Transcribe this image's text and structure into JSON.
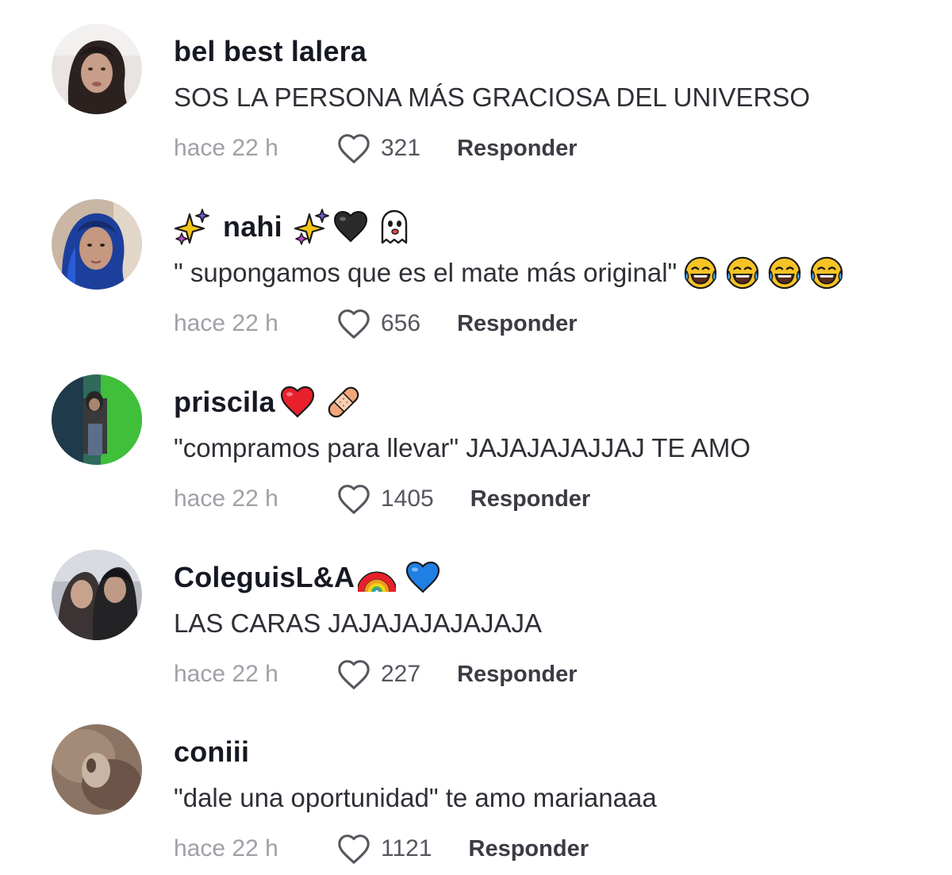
{
  "comments": [
    {
      "username": "bel best lalera",
      "text": "SOS LA PERSONA MÁS GRACIOSA DEL UNIVERSO",
      "time": "hace 22 h",
      "likes": "321",
      "reply_label": "Responder",
      "avatar_icon": "woman-portrait-avatar",
      "name_emojis": [],
      "text_emojis": []
    },
    {
      "username": "nahi",
      "text": "\" supongamos que es el mate más original\"",
      "time": "hace 22 h",
      "likes": "656",
      "reply_label": "Responder",
      "avatar_icon": "blue-hair-avatar",
      "name_emojis": [
        "sparkles-icon",
        "sparkles-icon",
        "black-heart-icon",
        "ghost-icon"
      ],
      "text_emojis": [
        "tears-of-joy-icon",
        "tears-of-joy-icon",
        "tears-of-joy-icon",
        "tears-of-joy-icon"
      ]
    },
    {
      "username": "priscila",
      "text": "\"compramos para llevar\" JAJAJAJAJJAJ TE AMO",
      "time": "hace 22 h",
      "likes": "1405",
      "reply_label": "Responder",
      "avatar_icon": "green-room-avatar",
      "name_emojis": [
        "red-heart-icon",
        "adhesive-bandage-icon"
      ],
      "text_emojis": []
    },
    {
      "username": "ColeguisL&A",
      "text": "LAS CARAS JAJAJAJAJAJAJA",
      "time": "hace 22 h",
      "likes": "227",
      "reply_label": "Responder",
      "avatar_icon": "two-friends-avatar",
      "name_emojis": [
        "rainbow-icon",
        "blue-heart-icon"
      ],
      "text_emojis": []
    },
    {
      "username": "coniii",
      "text": "\"dale una oportunidad\" te amo marianaaa",
      "time": "hace 22 h",
      "likes": "1121",
      "reply_label": "Responder",
      "avatar_icon": "blurry-brown-avatar",
      "name_emojis": [],
      "text_emojis": []
    }
  ],
  "colors": {
    "username": "#161823",
    "text": "#2f3036",
    "time": "#9fa1a7",
    "reply": "#3b3c43"
  }
}
